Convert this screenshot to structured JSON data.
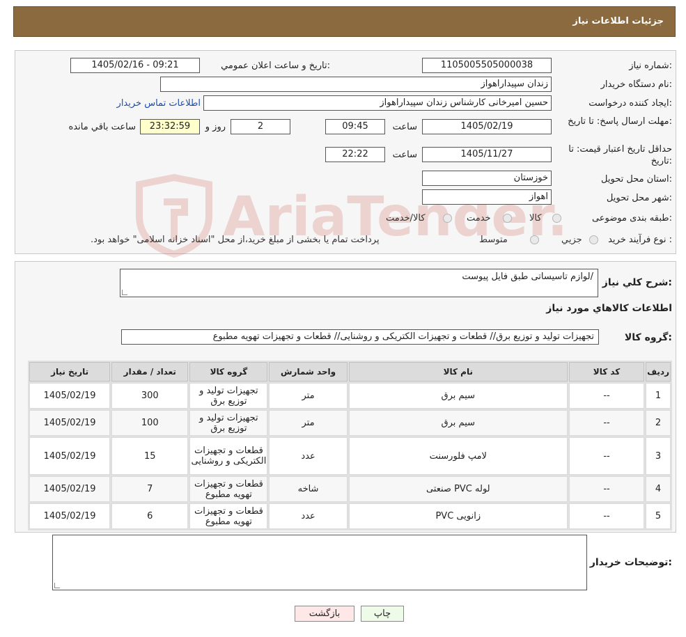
{
  "header": {
    "title": "جزئیات اطلاعات نیاز"
  },
  "info": {
    "need_number_label": "شماره نیاز:",
    "need_number": "1105005505000038",
    "announce_label": "تاریخ و ساعت اعلان عمومي:",
    "announce_value": "1405/02/16 - 09:21",
    "buyer_org_label": "نام دستگاه خريدار:",
    "buyer_org": "زندان سپیداراهواز",
    "requester_label": "ایجاد کننده درخواست:",
    "requester": "حسین امیرخانی کارشناس زندان سپیداراهواز",
    "contact_link": "اطلاعات تماس خريدار",
    "reply_deadline_label": "مهلت ارسال پاسخ: تا تاریخ:",
    "reply_date": "1405/02/19",
    "time_label": "ساعت",
    "reply_time": "09:45",
    "days": "2",
    "days_label": "روز و",
    "remaining": "23:32:59",
    "remaining_label": "ساعت باقي مانده",
    "validity_label": "حداقل تاريخ اعتبار قيمت: تا تاریخ:",
    "validity_date": "1405/11/27",
    "validity_time": "22:22",
    "province_label": "استان محل تحويل:",
    "province": "خوزستان",
    "city_label": "شهر محل تحويل:",
    "city": "اهواز",
    "category_label": "طبقه بندی موضوعی:",
    "category_options": [
      "كالا",
      "خدمت",
      "كالا/خدمت"
    ],
    "process_label": "نوع فرآيند خريد :",
    "process_options": [
      "جزيي",
      "متوسط"
    ],
    "process_note": "پرداخت تمام يا بخشی از مبلغ خريد،از محل \"اسناد خزانه اسلامی\" خواهد بود."
  },
  "description": {
    "label": "شرح کلي نياز:",
    "value": "لوازم تاسیساتی طبق فایل پیوست/"
  },
  "goods": {
    "section_title": "اطلاعات كالاهاي مورد نياز",
    "group_label": "گروه كالا:",
    "group_value": "تجهیزات تولید و توزیع برق// قطعات و تجهیزات الکتریکی و روشنایی//  قطعات و تجهیزات تهویه مطبوع"
  },
  "table": {
    "headers": [
      "رديف",
      "كد كالا",
      "نام كالا",
      "واحد شمارش",
      "گروه كالا",
      "تعداد / مقدار",
      "تاريخ نياز"
    ],
    "rows": [
      [
        "1",
        "--",
        "سیم برق",
        "متر",
        "تجهیزات تولید و توزیع برق",
        "300",
        "1405/02/19"
      ],
      [
        "2",
        "--",
        "سیم برق",
        "متر",
        "تجهیزات تولید و توزیع برق",
        "100",
        "1405/02/19"
      ],
      [
        "3",
        "--",
        "لامپ فلورسنت",
        "عدد",
        "قطعات و تجهیزات الکتریکی و روشنایی",
        "15",
        "1405/02/19"
      ],
      [
        "4",
        "--",
        "لوله PVC صنعتی",
        "شاخه",
        "قطعات و تجهیزات تهویه مطبوع",
        "7",
        "1405/02/19"
      ],
      [
        "5",
        "--",
        "زانویی PVC",
        "عدد",
        "قطعات و تجهیزات تهویه مطبوع",
        "6",
        "1405/02/19"
      ]
    ]
  },
  "buyer_notes": {
    "label": "توضيحات خريدار:",
    "value": ""
  },
  "buttons": {
    "print": "چاپ",
    "back": "بازگشت"
  },
  "watermark": {
    "text": "AriaTender.neT"
  }
}
